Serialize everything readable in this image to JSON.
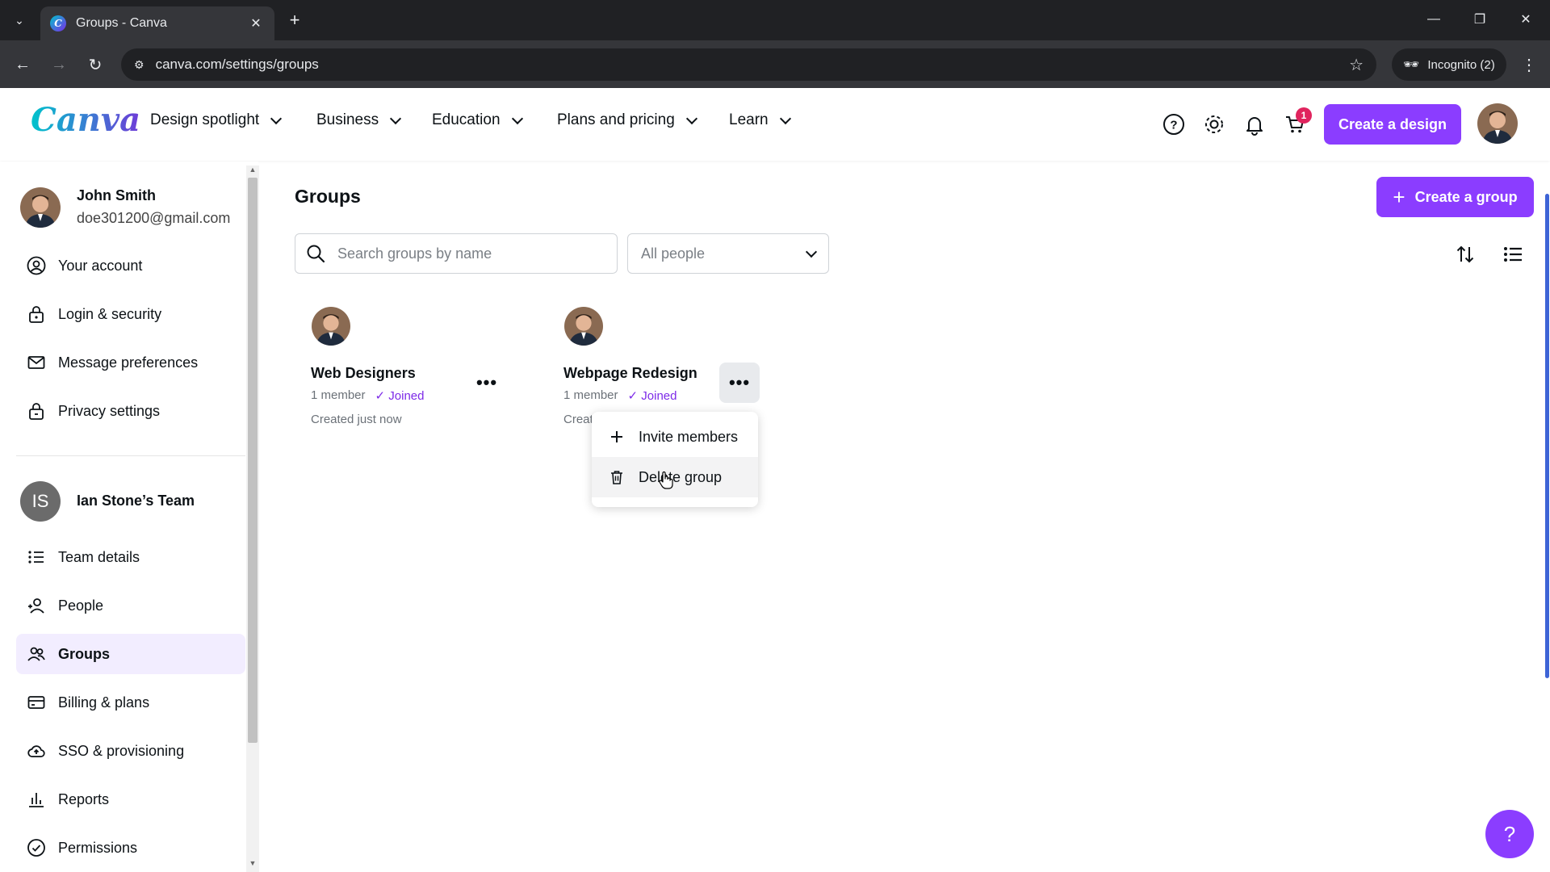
{
  "browser": {
    "tab_title": "Groups - Canva",
    "url": "canva.com/settings/groups",
    "profile_label": "Incognito (2)"
  },
  "header": {
    "logo": "Canva",
    "nav": [
      "Design spotlight",
      "Business",
      "Education",
      "Plans and pricing",
      "Learn"
    ],
    "cart_count": "1",
    "create_design": "Create a design"
  },
  "sidebar": {
    "user": {
      "name": "John Smith",
      "email": "doe301200@gmail.com"
    },
    "personal_items": [
      "Your account",
      "Login & security",
      "Message preferences",
      "Privacy settings"
    ],
    "team": {
      "initials": "IS",
      "name": "Ian Stone’s Team"
    },
    "team_items": [
      "Team details",
      "People",
      "Groups",
      "Billing & plans",
      "SSO & provisioning",
      "Reports",
      "Permissions"
    ],
    "active_item": "Groups"
  },
  "main": {
    "title": "Groups",
    "create_group": "Create a group",
    "search_placeholder": "Search groups by name",
    "people_filter": "All people",
    "groups": [
      {
        "name": "Web Designers",
        "members": "1 member",
        "status": "Joined",
        "created": "Created just now"
      },
      {
        "name": "Webpage Redesign",
        "members": "1 member",
        "status": "Joined",
        "created": "Creat"
      }
    ],
    "menu": [
      "Invite members",
      "Delete group"
    ]
  },
  "help_fab": "?",
  "colors": {
    "accent": "#8b3dff",
    "joined": "#7d2ae8",
    "badge": "#e0245e"
  }
}
